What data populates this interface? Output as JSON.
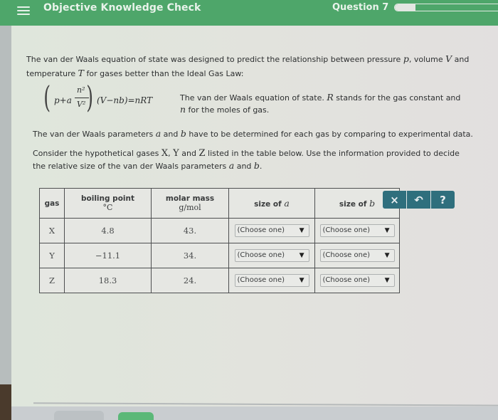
{
  "header": {
    "menu_icon": "hamburger-menu-icon",
    "title": "Objective Knowledge Check",
    "question_label": "Question 7",
    "progress_fraction": 0.18
  },
  "colors": {
    "header_green": "#4ea66a",
    "button_teal": "#2f6f7d"
  },
  "content": {
    "intro_part1": "The van der Waals equation of state was designed to predict the relationship between pressure ",
    "intro_p": "p",
    "intro_part2": ", volume ",
    "intro_V": "V",
    "intro_part3": " and temperature ",
    "intro_T": "T",
    "intro_part4": " for gases better than the Ideal Gas Law:",
    "equation": {
      "p_plus_a": "p+a",
      "numerator": "n²",
      "denominator": "V²",
      "rest": "(V−nb)=nRT"
    },
    "eq_desc_part1": "The van der Waals equation of state. ",
    "eq_desc_R": "R",
    "eq_desc_part2": " stands for the gas constant and ",
    "eq_desc_n": "n",
    "eq_desc_part3": " for the moles of gas.",
    "para2_part1": "The van der Waals parameters ",
    "para2_a": "a",
    "para2_part2": " and ",
    "para2_b": "b",
    "para2_part3": " have to be determined for each gas by comparing to experimental data.",
    "para3_part1": "Consider the hypothetical gases ",
    "para3_X": "X",
    "para3_sep1": ", ",
    "para3_Y": "Y",
    "para3_sep2": " and ",
    "para3_Z": "Z",
    "para3_part2": " listed in the table below. Use the information provided to decide the relative size of the van der Waals parameters ",
    "para3_a": "a",
    "para3_and": " and ",
    "para3_b": "b",
    "para3_end": "."
  },
  "table": {
    "headers": {
      "gas": "gas",
      "boiling_point": "boiling point",
      "boiling_point_unit": "°C",
      "molar_mass": "molar mass",
      "molar_mass_unit": "g/mol",
      "size_a_prefix": "size of ",
      "size_a_var": "a",
      "size_b_prefix": "size of ",
      "size_b_var": "b"
    },
    "rows": [
      {
        "gas": "X",
        "boiling_point": "4.8",
        "molar_mass": "43.",
        "size_a": "(Choose one)",
        "size_b": "(Choose one)"
      },
      {
        "gas": "Y",
        "boiling_point": "−11.1",
        "molar_mass": "34.",
        "size_a": "(Choose one)",
        "size_b": "(Choose one)"
      },
      {
        "gas": "Z",
        "boiling_point": "18.3",
        "molar_mass": "24.",
        "size_a": "(Choose one)",
        "size_b": "(Choose one)"
      }
    ],
    "caret": "▼"
  },
  "actions": {
    "clear": "×",
    "undo": "↶",
    "help": "?"
  }
}
